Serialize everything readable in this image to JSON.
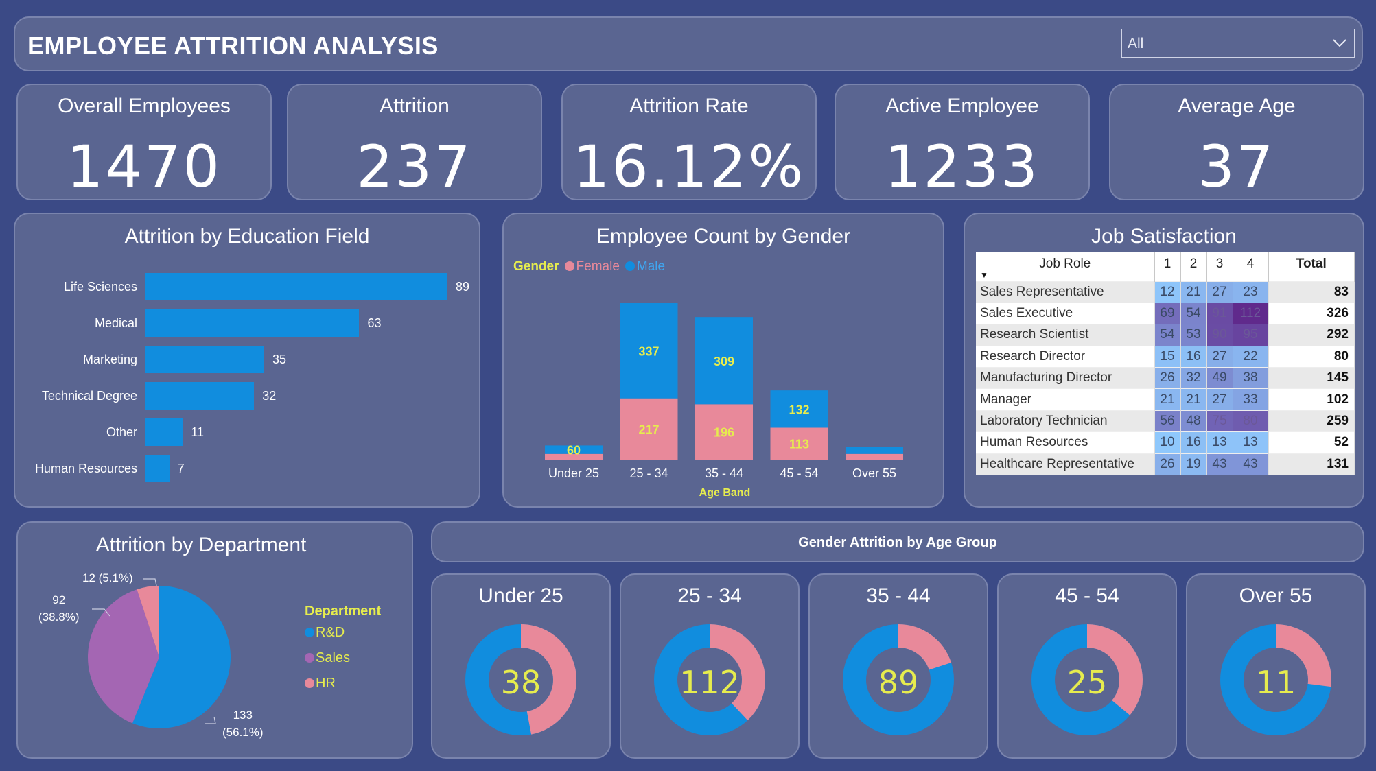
{
  "header": {
    "title": "EMPLOYEE ATTRITION ANALYSIS",
    "filter_value": "All"
  },
  "kpis": [
    {
      "label": "Overall Employees",
      "value": "1470"
    },
    {
      "label": "Attrition",
      "value": "237"
    },
    {
      "label": "Attrition Rate",
      "value": "16.12%"
    },
    {
      "label": "Active Employee",
      "value": "1233"
    },
    {
      "label": "Average Age",
      "value": "37"
    }
  ],
  "colors": {
    "male": "#118dde",
    "female": "#e8899a",
    "sales": "#a466b3",
    "hr": "#e8899a",
    "accent": "#e6ec4e"
  },
  "education": {
    "title": "Attrition by Education Field"
  },
  "gender": {
    "title": "Employee Count by Gender",
    "legend_title": "Gender",
    "legend": [
      "Female",
      "Male"
    ],
    "xlabel": "Age Band"
  },
  "job": {
    "title": "Job Satisfaction",
    "columns": [
      "Job Role",
      "1",
      "2",
      "3",
      "4",
      "Total"
    ],
    "rows": [
      {
        "role": "Sales Representative",
        "v": [
          12,
          21,
          27,
          23
        ],
        "total": 83
      },
      {
        "role": "Sales Executive",
        "v": [
          69,
          54,
          91,
          112
        ],
        "total": 326
      },
      {
        "role": "Research Scientist",
        "v": [
          54,
          53,
          90,
          95
        ],
        "total": 292
      },
      {
        "role": "Research Director",
        "v": [
          15,
          16,
          27,
          22
        ],
        "total": 80
      },
      {
        "role": "Manufacturing Director",
        "v": [
          26,
          32,
          49,
          38
        ],
        "total": 145
      },
      {
        "role": "Manager",
        "v": [
          21,
          21,
          27,
          33
        ],
        "total": 102
      },
      {
        "role": "Laboratory Technician",
        "v": [
          56,
          48,
          75,
          80
        ],
        "total": 259
      },
      {
        "role": "Human Resources",
        "v": [
          10,
          16,
          13,
          13
        ],
        "total": 52
      },
      {
        "role": "Healthcare Representative",
        "v": [
          26,
          19,
          43,
          43
        ],
        "total": 131
      }
    ]
  },
  "department": {
    "title": "Attrition by Department",
    "legend_title": "Department",
    "legend": [
      "R&D",
      "Sales",
      "HR"
    ],
    "labels": {
      "rd": [
        "133",
        "(56.1%)"
      ],
      "sales": [
        "92",
        "(38.8%)"
      ],
      "hr": "12 (5.1%)"
    }
  },
  "age_group": {
    "title": "Gender Attrition by Age Group",
    "cards": [
      {
        "label": "Under 25",
        "value": "38"
      },
      {
        "label": "25 - 34",
        "value": "112"
      },
      {
        "label": "35 - 44",
        "value": "89"
      },
      {
        "label": "45 - 54",
        "value": "25"
      },
      {
        "label": "Over 55",
        "value": "11"
      }
    ]
  },
  "chart_data": [
    {
      "type": "bar",
      "title": "Attrition by Education Field",
      "orientation": "horizontal",
      "categories": [
        "Life Sciences",
        "Medical",
        "Marketing",
        "Technical Degree",
        "Other",
        "Human Resources"
      ],
      "values": [
        89,
        63,
        35,
        32,
        11,
        7
      ]
    },
    {
      "type": "bar",
      "stacked": true,
      "title": "Employee Count by Gender",
      "xlabel": "Age Band",
      "categories": [
        "Under 25",
        "25 - 34",
        "35 - 44",
        "45 - 54",
        "Over 55"
      ],
      "series": [
        {
          "name": "Female",
          "values": [
            20,
            217,
            196,
            113,
            20
          ],
          "labels": [
            "",
            "217",
            "196",
            "113",
            ""
          ]
        },
        {
          "name": "Male",
          "values": [
            30,
            337,
            309,
            132,
            25
          ],
          "labels": [
            "60",
            "337",
            "309",
            "132",
            ""
          ]
        }
      ]
    },
    {
      "type": "pie",
      "title": "Attrition by Department",
      "categories": [
        "R&D",
        "Sales",
        "HR"
      ],
      "values": [
        133,
        92,
        12
      ]
    },
    {
      "type": "pie",
      "title": "Gender Attrition by Age Group",
      "donuts": [
        {
          "label": "Under 25",
          "total": 38,
          "female_fraction": 0.47
        },
        {
          "label": "25 - 34",
          "total": 112,
          "female_fraction": 0.38
        },
        {
          "label": "35 - 44",
          "total": 89,
          "female_fraction": 0.2
        },
        {
          "label": "45 - 54",
          "total": 25,
          "female_fraction": 0.36
        },
        {
          "label": "Over 55",
          "total": 11,
          "female_fraction": 0.27
        }
      ]
    }
  ]
}
